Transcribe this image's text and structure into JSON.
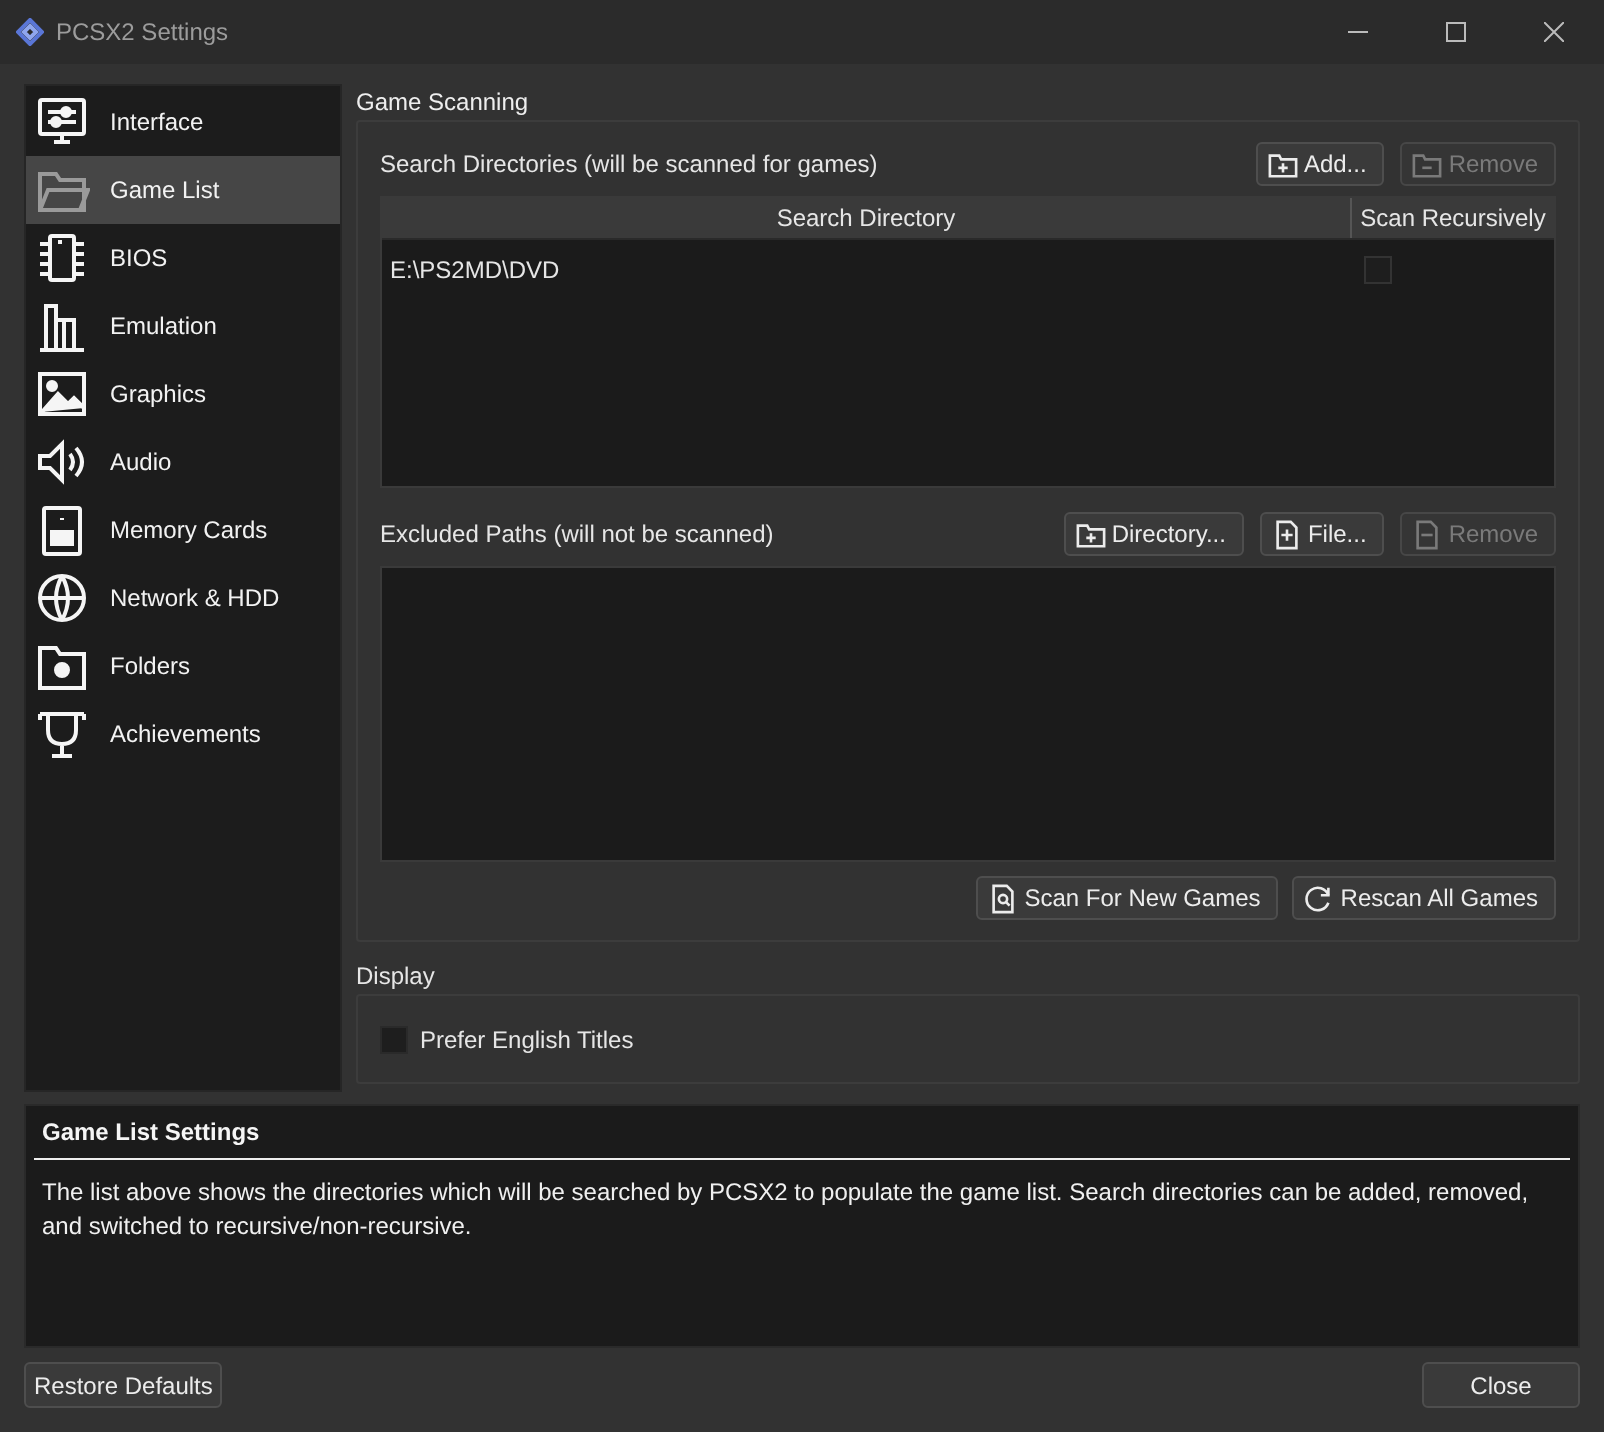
{
  "window": {
    "title": "PCSX2 Settings"
  },
  "sidebar": {
    "items": [
      {
        "label": "Interface",
        "selected": false
      },
      {
        "label": "Game List",
        "selected": true
      },
      {
        "label": "BIOS",
        "selected": false
      },
      {
        "label": "Emulation",
        "selected": false
      },
      {
        "label": "Graphics",
        "selected": false
      },
      {
        "label": "Audio",
        "selected": false
      },
      {
        "label": "Memory Cards",
        "selected": false
      },
      {
        "label": "Network & HDD",
        "selected": false
      },
      {
        "label": "Folders",
        "selected": false
      },
      {
        "label": "Achievements",
        "selected": false
      }
    ]
  },
  "game_scanning": {
    "title": "Game Scanning",
    "search_directories": {
      "label": "Search Directories (will be scanned for games)",
      "buttons": [
        {
          "label": "Add...",
          "disabled": false
        },
        {
          "label": "Remove",
          "disabled": true
        }
      ],
      "columns": [
        "Search Directory",
        "Scan Recursively"
      ],
      "rows": [
        {
          "search_directory": "E:\\PS2MD\\DVD",
          "scan_recursively": false
        }
      ]
    },
    "excluded_paths": {
      "label": "Excluded Paths (will not be scanned)",
      "buttons": [
        {
          "label": "Directory...",
          "disabled": false
        },
        {
          "label": "File...",
          "disabled": false
        },
        {
          "label": "Remove",
          "disabled": true
        }
      ]
    },
    "actions": [
      {
        "label": "Scan For New Games"
      },
      {
        "label": "Rescan All Games"
      }
    ]
  },
  "display": {
    "title": "Display",
    "prefer_english_titles": {
      "label": "Prefer English Titles",
      "checked": false
    }
  },
  "help": {
    "title": "Game List Settings",
    "text": "The list above shows the directories which will be searched by PCSX2 to populate the game list. Search directories can be added, removed, and switched to recursive/non-recursive."
  },
  "footer": {
    "buttons": [
      {
        "label": "Restore Defaults"
      },
      {
        "label": "Close"
      }
    ]
  }
}
